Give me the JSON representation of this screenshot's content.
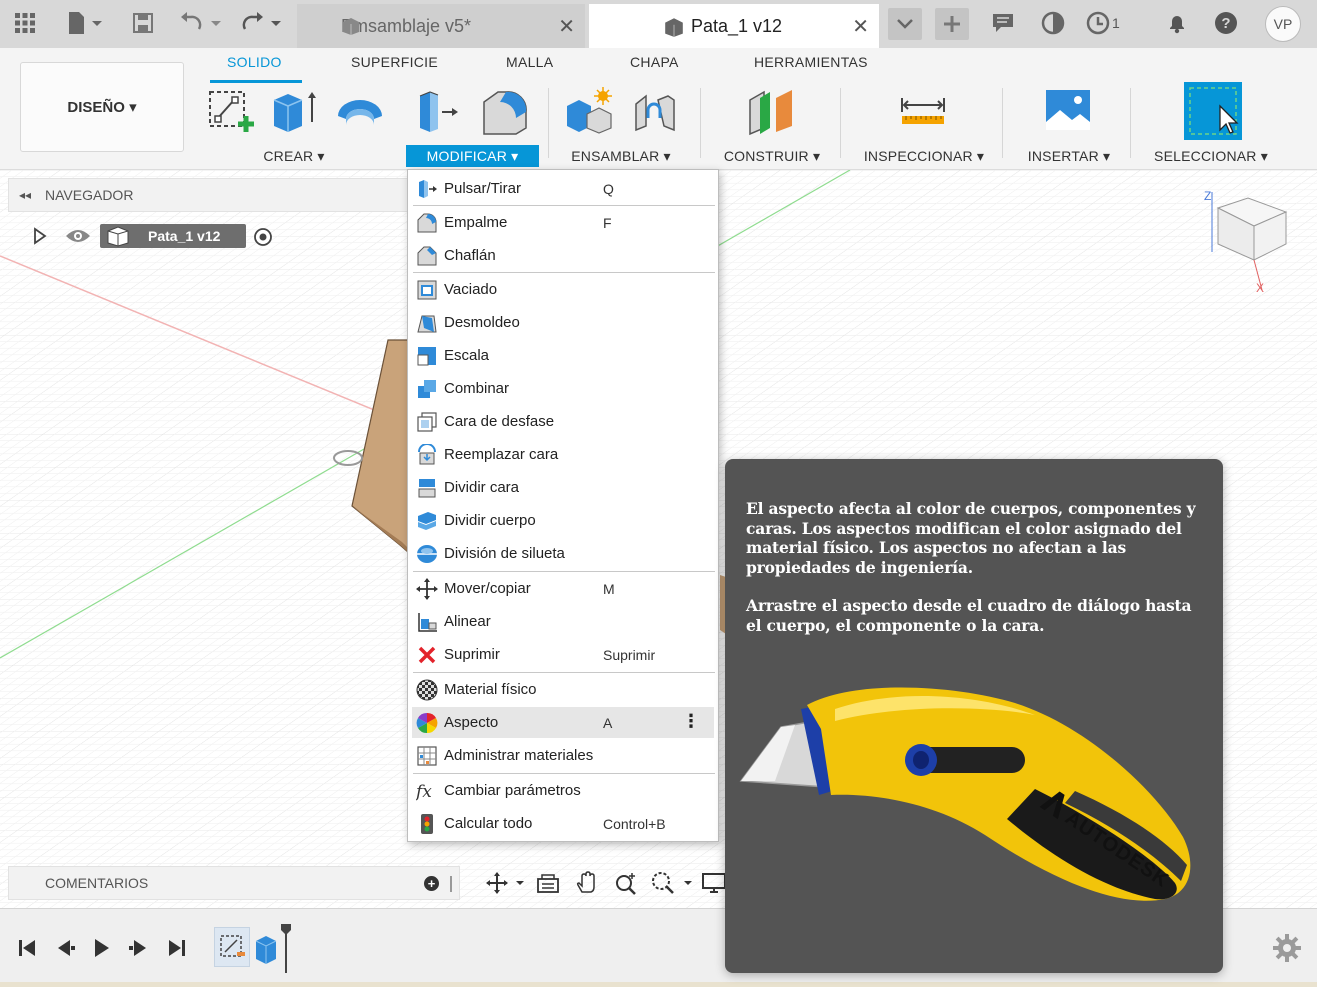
{
  "titlebar": {
    "tab_inactive": "Emsamblaje v5*",
    "tab_active": "Pata_1 v12",
    "close_glyph": "✕",
    "jobs_count": "1",
    "user_initials": "VP"
  },
  "ribbon": {
    "workspace": "DISEÑO ▾",
    "tabs": [
      "SOLIDO",
      "SUPERFICIE",
      "MALLA",
      "CHAPA",
      "HERRAMIENTAS"
    ],
    "groups": [
      "CREAR ▾",
      "MODIFICAR ▾",
      "ENSAMBLAR ▾",
      "CONSTRUIR ▾",
      "INSPECCIONAR ▾",
      "INSERTAR ▾",
      "SELECCIONAR ▾"
    ],
    "accent_color": "#0696d7"
  },
  "browser": {
    "title": "NAVEGADOR",
    "component": "Pata_1 v12"
  },
  "comments": {
    "title": "COMENTARIOS"
  },
  "menu": {
    "items": [
      {
        "label": "Pulsar/Tirar",
        "shortcut": "Q",
        "icon": "press-pull-icon"
      },
      {
        "label": "Empalme",
        "shortcut": "F",
        "icon": "fillet-icon"
      },
      {
        "label": "Chaflán",
        "shortcut": "",
        "icon": "chamfer-icon"
      },
      {
        "label": "Vaciado",
        "shortcut": "",
        "icon": "shell-icon"
      },
      {
        "label": "Desmoldeo",
        "shortcut": "",
        "icon": "draft-icon"
      },
      {
        "label": "Escala",
        "shortcut": "",
        "icon": "scale-icon"
      },
      {
        "label": "Combinar",
        "shortcut": "",
        "icon": "combine-icon"
      },
      {
        "label": "Cara de desfase",
        "shortcut": "",
        "icon": "offset-face-icon"
      },
      {
        "label": "Reemplazar cara",
        "shortcut": "",
        "icon": "replace-face-icon"
      },
      {
        "label": "Dividir cara",
        "shortcut": "",
        "icon": "split-face-icon"
      },
      {
        "label": "Dividir cuerpo",
        "shortcut": "",
        "icon": "split-body-icon"
      },
      {
        "label": "División de silueta",
        "shortcut": "",
        "icon": "silhouette-split-icon"
      },
      {
        "label": "Mover/copiar",
        "shortcut": "M",
        "icon": "move-icon"
      },
      {
        "label": "Alinear",
        "shortcut": "",
        "icon": "align-icon"
      },
      {
        "label": "Suprimir",
        "shortcut": "Suprimir",
        "icon": "delete-icon"
      },
      {
        "label": "Material físico",
        "shortcut": "",
        "icon": "physical-material-icon"
      },
      {
        "label": "Aspecto",
        "shortcut": "A",
        "icon": "appearance-icon"
      },
      {
        "label": "Administrar materiales",
        "shortcut": "",
        "icon": "manage-materials-icon"
      },
      {
        "label": "Cambiar parámetros",
        "shortcut": "",
        "icon": "parameters-icon"
      },
      {
        "label": "Calcular todo",
        "shortcut": "Control+B",
        "icon": "compute-all-icon"
      }
    ],
    "more_glyph": "⋮"
  },
  "tooltip": {
    "paragraph_1": "El aspecto afecta al color de cuerpos, componentes y caras. Los aspectos modifican el color asignado del material físico. Los aspectos no afectan a las propiedades de ingeniería.",
    "paragraph_2": "Arrastre el aspecto desde el cuadro de diálogo hasta el cuerpo, el componente o la cara.",
    "image_brand": "AUTODESK"
  },
  "viewcube": {
    "axis_z": "Z",
    "axis_x": "X"
  }
}
